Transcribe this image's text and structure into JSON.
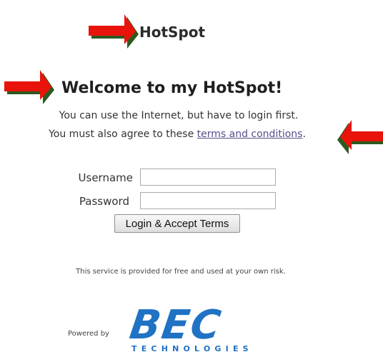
{
  "header": {
    "site_title": "HotSpot"
  },
  "main": {
    "welcome_heading": "Welcome to my HotSpot!",
    "intro_line1": "You can use the Internet, but have to login first.",
    "intro_line2_prefix": "You must also agree to these ",
    "terms_link": "terms and conditions",
    "intro_line2_suffix": "."
  },
  "login_form": {
    "username_label": "Username",
    "username_value": "",
    "password_label": "Password",
    "password_value": "",
    "submit_label": "Login & Accept Terms"
  },
  "footer": {
    "disclaimer": "This service is provided for free and used at your own risk.",
    "powered_by": "Powered by",
    "logo_mark": "BEC",
    "logo_subtitle": "TECHNOLOGIES"
  },
  "annotations": {
    "arrow_color": "#e8140c",
    "arrow_shadow_color": "#2d5a1f",
    "arrows": [
      "arrow-right-icon",
      "arrow-right-icon",
      "arrow-left-icon"
    ]
  },
  "colors": {
    "link": "#5b4b8a",
    "brand_blue": "#1f72c4"
  }
}
